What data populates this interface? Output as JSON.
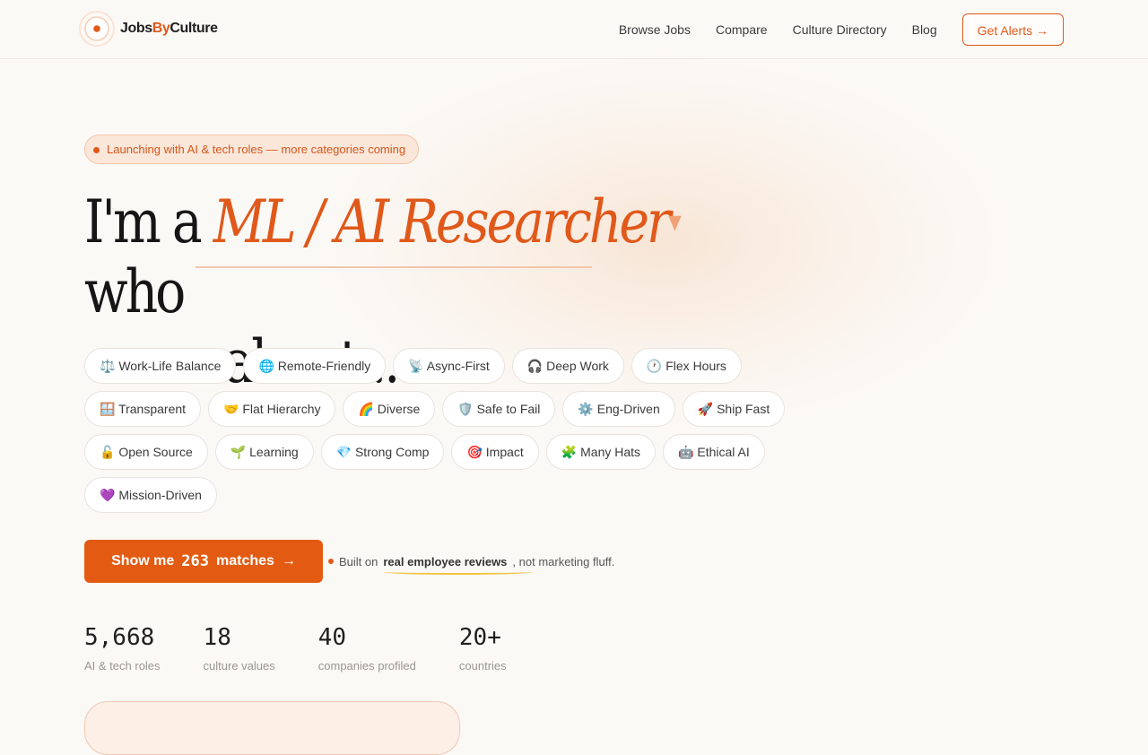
{
  "brand": {
    "part1": "Jobs",
    "part2": "By",
    "part3": "Culture",
    "accent": "#e0591a"
  },
  "nav": {
    "items": [
      "Browse Jobs",
      "Compare",
      "Culture Directory",
      "Blog"
    ],
    "alerts_label": "Get Alerts",
    "alerts_arrow": "→"
  },
  "badge": {
    "text": "Launching with AI & tech roles — more categories coming"
  },
  "hero": {
    "prefix": "I'm a ",
    "role": "ML / AI Researcher",
    "caret": "▾",
    "suffix": " who",
    "line2": "cares about..."
  },
  "values": [
    [
      "⚖️ Work-Life Balance",
      "🌐 Remote-Friendly",
      "📡 Async-First",
      "🎧 Deep Work",
      "🕐 Flex Hours"
    ],
    [
      "🪟 Transparent",
      "🤝 Flat Hierarchy",
      "🌈 Diverse",
      "🛡️ Safe to Fail",
      "⚙️ Eng-Driven",
      "🚀 Ship Fast"
    ],
    [
      "🔓 Open Source",
      "🌱 Learning",
      "💎 Strong Comp",
      "🎯 Impact",
      "🧩 Many Hats",
      "🤖 Ethical AI"
    ],
    [
      "💜 Mission-Driven"
    ]
  ],
  "cta": {
    "pre": "Show me",
    "count": "263",
    "post": "matches",
    "arrow": "→"
  },
  "note": {
    "pre": "Built on",
    "strong": "real employee reviews",
    "post": ", not marketing fluff."
  },
  "stats": [
    {
      "value": "5,668",
      "label": "AI & tech roles"
    },
    {
      "value": "18",
      "label": "culture values"
    },
    {
      "value": "40",
      "label": "companies profiled"
    },
    {
      "value": "20+",
      "label": "countries"
    }
  ]
}
